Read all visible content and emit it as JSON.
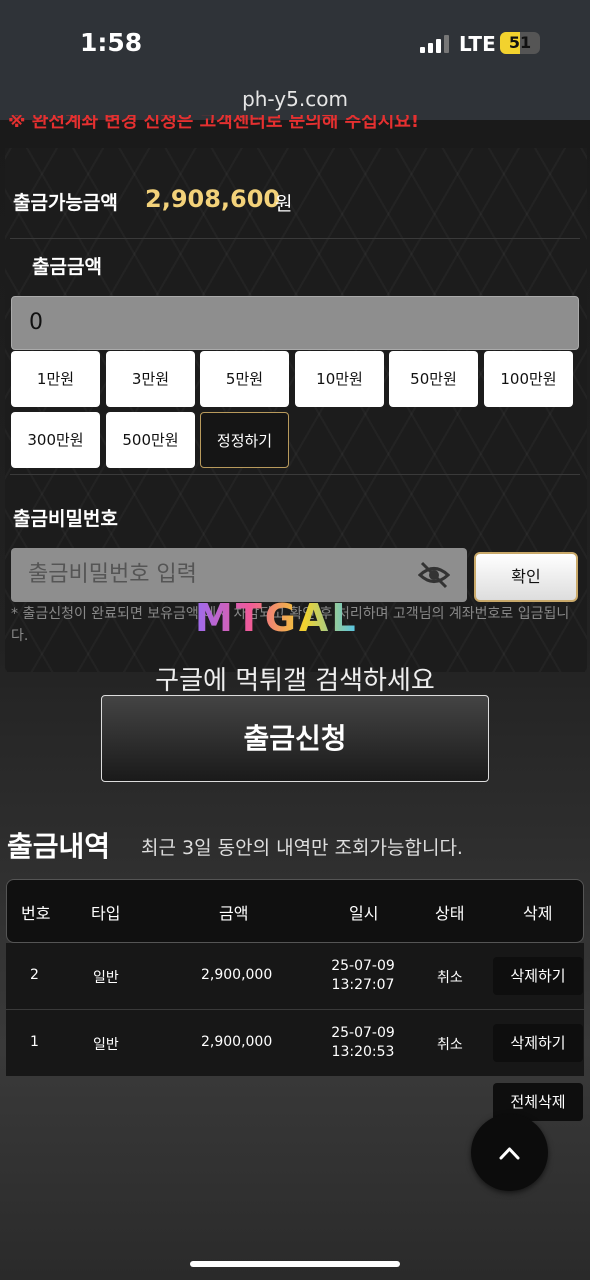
{
  "status_bar": {
    "time": "1:58",
    "network": "LTE",
    "battery": "51",
    "battery_level": 0.51
  },
  "browser": {
    "url": "ph-y5.com"
  },
  "notice": "※ 완전계좌 변경 신청은 고객센터로 문의해 주십시요!",
  "withdraw": {
    "available_label": "출금가능금액",
    "available_amount": "2,908,600",
    "available_unit": "원",
    "amount_label": "출금금액",
    "amount_value": "0",
    "quick_amounts": [
      "1만원",
      "3만원",
      "5만원",
      "10만원",
      "50만원",
      "100만원",
      "300만원",
      "500만원"
    ],
    "reset_label": "정정하기",
    "password_label": "출금비밀번호",
    "password_placeholder": "출금비밀번호 입력",
    "confirm_label": "확인",
    "note": "* 출금신청이 완료되면 보유금액 에서 차감되고 확인 후 처리하며 고객님의 계좌번호로 입금됩니다.",
    "submit_label": "출금신청"
  },
  "watermark": {
    "logo": "MTGAL",
    "text": "구글에 먹튀갤 검색하세요"
  },
  "history": {
    "title": "출금내역",
    "subtitle": "최근 3일 동안의 내역만 조회가능합니다.",
    "columns": [
      "번호",
      "타입",
      "금액",
      "일시",
      "상태",
      "삭제"
    ],
    "rows": [
      {
        "no": "2",
        "type": "일반",
        "amount": "2,900,000",
        "date": "25-07-09",
        "time": "13:27:07",
        "status": "취소",
        "delete_label": "삭제하기"
      },
      {
        "no": "1",
        "type": "일반",
        "amount": "2,900,000",
        "date": "25-07-09",
        "time": "13:20:53",
        "status": "취소",
        "delete_label": "삭제하기"
      }
    ],
    "delete_all_label": "전체삭제"
  }
}
